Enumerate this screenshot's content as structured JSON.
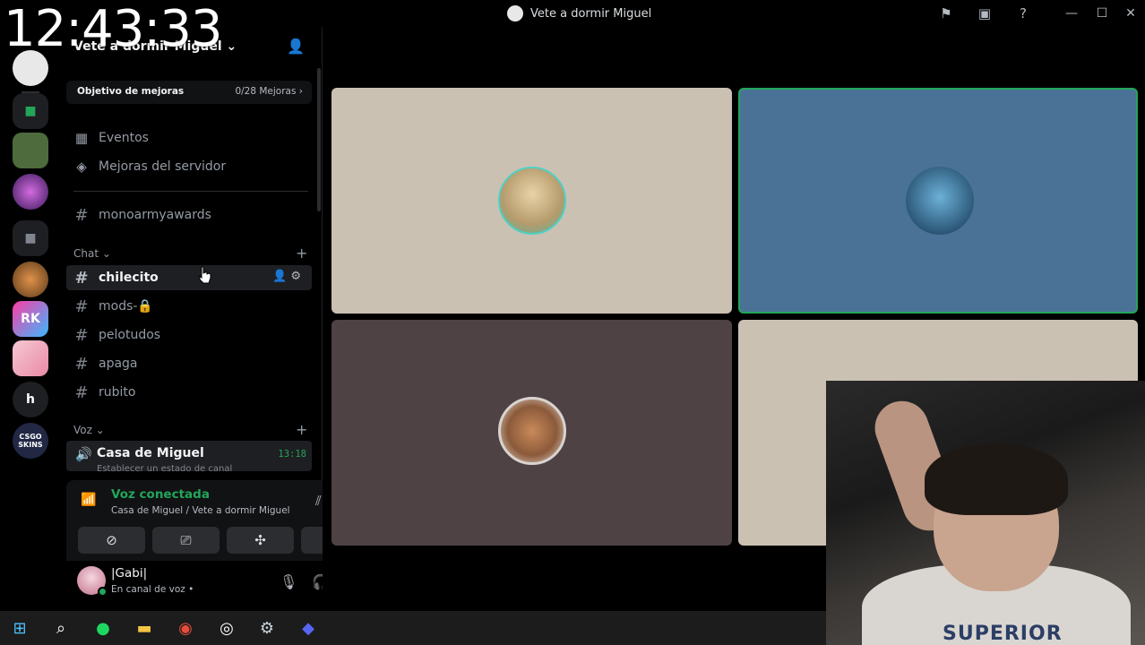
{
  "clock": "12:43:33",
  "window": {
    "title": "Vete a dormir Miguel"
  },
  "server": {
    "name": "Vete a dormir Miguel",
    "boost_goal_label": "Objetivo de mejoras",
    "boost_goal_progress": "0/28 Mejoras"
  },
  "nav": {
    "events": "Eventos",
    "boosts": "Mejoras del servidor"
  },
  "channels": {
    "top": "monoarmyawards",
    "chat_category": "Chat",
    "chat": [
      "chilecito",
      "mods-🔒",
      "pelotudos",
      "apaga",
      "rubito"
    ],
    "voice_category": "Voz",
    "voice_channel": "Casa de Miguel",
    "voice_time": "13:18",
    "voice_status": "Establecer un estado de canal"
  },
  "voice_panel": {
    "title": "Voz conectada",
    "subtitle": "Casa de Miguel / Vete a dormir Miguel"
  },
  "user": {
    "name": "|Gabi|",
    "status": "En canal de voz •"
  },
  "guild_labels": {
    "h": "h",
    "rk": "RK",
    "csgo": "CSGO SKINS"
  },
  "webcam": {
    "shirt_text": "SUPERIOR"
  },
  "colors": {
    "accent_green": "#23a55a",
    "tile_beige": "#cbc1b2",
    "tile_blue": "#4a7297",
    "tile_mauve": "#4e4245"
  }
}
